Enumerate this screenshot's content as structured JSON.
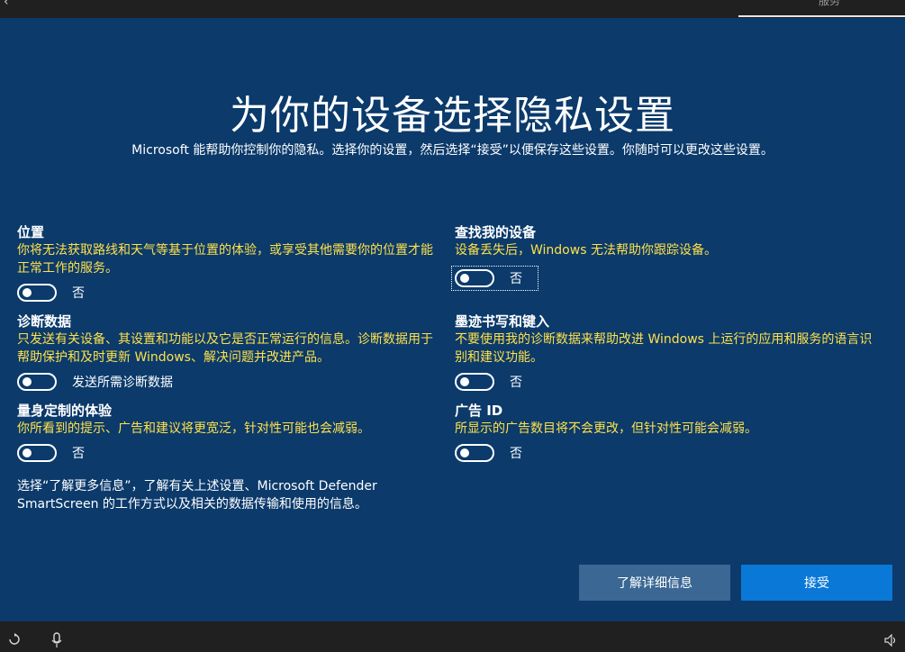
{
  "topbar": {
    "back_glyph": "‹",
    "right_label": "服务"
  },
  "page": {
    "title": "为你的设备选择隐私设置",
    "subtitle": "Microsoft 能帮助你控制你的隐私。选择你的设置，然后选择“接受”以便保存这些设置。你随时可以更改这些设置。"
  },
  "settings": {
    "location": {
      "title": "位置",
      "description": "你将无法获取路线和天气等基于位置的体验，或享受其他需要你的位置才能正常工作的服务。",
      "toggle_label": "否"
    },
    "find_device": {
      "title": "查找我的设备",
      "description": "设备丢失后，Windows 无法帮助你跟踪设备。",
      "toggle_label": "否"
    },
    "diagnostics": {
      "title": "诊断数据",
      "description": "只发送有关设备、其设置和功能以及它是否正常运行的信息。诊断数据用于帮助保护和及时更新 Windows、解决问题并改进产品。",
      "toggle_label": "发送所需诊断数据"
    },
    "inking": {
      "title": "墨迹书写和键入",
      "description": "不要使用我的诊断数据来帮助改进 Windows 上运行的应用和服务的语言识别和建议功能。",
      "toggle_label": "否"
    },
    "tailored": {
      "title": "量身定制的体验",
      "description": "你所看到的提示、广告和建议将更宽泛，针对性可能也会减弱。",
      "toggle_label": "否"
    },
    "ad_id": {
      "title": "广告 ID",
      "description": "所显示的广告数目将不会更改，但针对性可能会减弱。",
      "toggle_label": "否"
    }
  },
  "info_text": "选择“了解更多信息”，了解有关上述设置、Microsoft Defender SmartScreen 的工作方式以及相关的数据传输和使用的信息。",
  "buttons": {
    "learn_more": "了解详细信息",
    "accept": "接受"
  },
  "bottombar": {
    "icons": [
      "ease-of-access-icon",
      "microphone-icon",
      "volume-icon"
    ]
  },
  "colors": {
    "background": "#0b3a6b",
    "description_text": "#ffe14a",
    "accept_button": "#0a78d7",
    "learn_button": "#3a6794",
    "bar": "#202020"
  }
}
